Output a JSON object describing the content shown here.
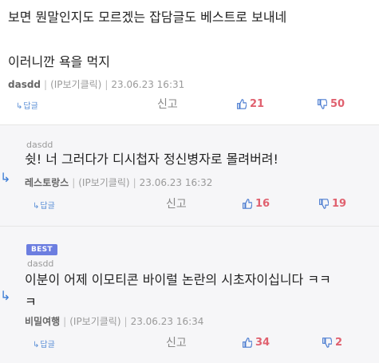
{
  "comments": [
    {
      "text": "보면 뭔말인지도 모르겠는 잡담글도 베스트로 보내네\n\n이러니깐 욕을 먹지",
      "nick": "dasdd",
      "ip": "(IP보기클릭)",
      "date": "23.06.23 16:31",
      "reply": "답글",
      "report": "신고",
      "likes": "21",
      "dislikes": "50"
    },
    {
      "parent_author": "dasdd",
      "text": "쉿! 너 그러다가 디시첩자 정신병자로 몰려버려!",
      "nick": "레스토랑스",
      "ip": "(IP보기클릭)",
      "date": "23.06.23 16:32",
      "reply": "답글",
      "report": "신고",
      "likes": "16",
      "dislikes": "19"
    },
    {
      "badge": "BEST",
      "parent_author": "dasdd",
      "text": "이분이 어제 이모티콘 바이럴 논란의 시초자이십니다 ㅋㅋ\nㅋ",
      "nick": "비밀여행",
      "ip": "(IP보기클릭)",
      "date": "23.06.23 16:34",
      "reply": "답글",
      "report": "신고",
      "likes": "34",
      "dislikes": "2"
    }
  ],
  "colors": {
    "accent_link": "#5b8fd6",
    "like": "#e0616f",
    "best_badge": "#6c7ee0"
  },
  "icons": [
    "reply-arrow-icon",
    "thumbs-up-icon",
    "thumbs-down-icon"
  ]
}
